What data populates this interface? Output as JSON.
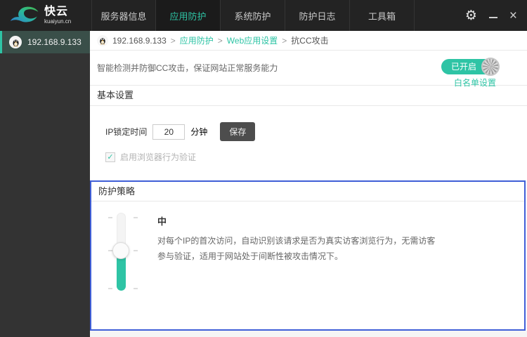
{
  "app": {
    "accent_color": "#2ec4a5",
    "focus_border_color": "#3f5ed7",
    "status_on_color": "#2ec4a5"
  },
  "topbar": {
    "logo_title": "快云",
    "logo_subtitle": "kuaiyun.cn",
    "nav": [
      {
        "label": "服务器信息"
      },
      {
        "label": "应用防护",
        "active": true
      },
      {
        "label": "系统防护"
      },
      {
        "label": "防护日志"
      },
      {
        "label": "工具箱"
      }
    ],
    "gear_glyph": "⚙",
    "close_glyph": "×"
  },
  "sidebar": {
    "server": "192.168.9.133",
    "os": "linux"
  },
  "breadcrumb": {
    "separator": ">",
    "items": [
      "192.168.9.133",
      "应用防护",
      "Web应用设置",
      "抗CC攻击"
    ]
  },
  "intro": {
    "text": "智能检测并防御CC攻击，保证网站正常服务能力",
    "status_label": "已开启",
    "whitelist_label": "白名单设置"
  },
  "basic": {
    "title": "基本设置",
    "ip_lock_label": "IP锁定时间",
    "ip_lock_value": "20",
    "ip_lock_unit": "分钟",
    "save_label": "保存",
    "browser_check_label": "启用浏览器行为验证",
    "browser_check_checked": true,
    "check_glyph": "✓"
  },
  "policy": {
    "title": "防护策略",
    "level": "中",
    "desc_line1": "对每个IP的首次访问，自动识别该请求是否为真实访客浏览行为，无需访客",
    "desc_line2": "参与验证，适用于网站处于间断性被攻击情况下。",
    "slider_positions": 3,
    "slider_current": "middle"
  }
}
